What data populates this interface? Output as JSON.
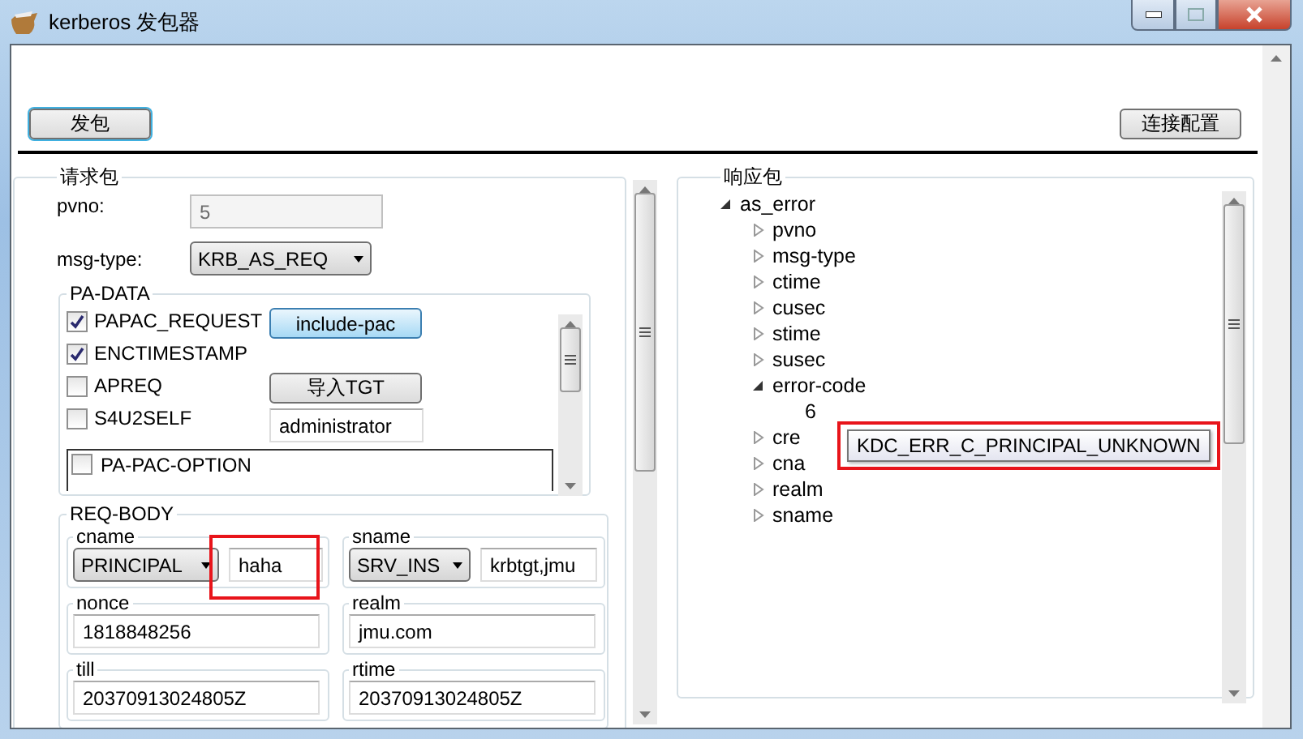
{
  "window": {
    "title": "kerberos 发包器"
  },
  "toolbar": {
    "send_button": "发包",
    "config_button": "连接配置"
  },
  "request": {
    "title": "请求包",
    "pvno": {
      "label": "pvno:",
      "value": "5",
      "disabled": true
    },
    "msg_type": {
      "label": "msg-type:",
      "value": "KRB_AS_REQ"
    },
    "pa_data": {
      "title": "PA-DATA",
      "options": [
        {
          "label": "PAPAC_REQUEST",
          "checked": true
        },
        {
          "label": "ENCTIMESTAMP",
          "checked": true
        },
        {
          "label": "APREQ",
          "checked": false
        },
        {
          "label": "S4U2SELF",
          "checked": false
        }
      ],
      "include_pac": {
        "label": "include-pac",
        "selected": true
      },
      "import_tgt": "导入TGT",
      "user": "administrator",
      "pac_option": {
        "label": "PA-PAC-OPTION",
        "checked": false
      }
    },
    "req_body": {
      "title": "REQ-BODY",
      "fields": [
        {
          "kind": "typed",
          "label": "cname",
          "type": "PRINCIPAL",
          "value": "haha",
          "highlighted": true
        },
        {
          "kind": "typed",
          "label": "sname",
          "type": "SRV_INS",
          "value": "krbtgt,jmu",
          "highlighted": false
        },
        {
          "kind": "text",
          "label": "nonce",
          "value": "1818848256"
        },
        {
          "kind": "text",
          "label": "realm",
          "value": "jmu.com"
        },
        {
          "kind": "text",
          "label": "till",
          "value": "20370913024805Z"
        },
        {
          "kind": "text",
          "label": "rtime",
          "value": "20370913024805Z"
        }
      ]
    }
  },
  "response": {
    "title": "响应包",
    "tree": [
      {
        "label": "as_error",
        "expanded": true,
        "children": [
          {
            "label": "pvno",
            "expanded": false
          },
          {
            "label": "msg-type",
            "expanded": false
          },
          {
            "label": "ctime",
            "expanded": false
          },
          {
            "label": "cusec",
            "expanded": false
          },
          {
            "label": "stime",
            "expanded": false
          },
          {
            "label": "susec",
            "expanded": false
          },
          {
            "label": "error-code",
            "expanded": true,
            "children": [
              {
                "label": "6"
              }
            ]
          },
          {
            "label": "cre",
            "expanded": false
          },
          {
            "label": "cna",
            "expanded": false
          },
          {
            "label": "realm",
            "expanded": false
          },
          {
            "label": "sname",
            "expanded": false
          }
        ]
      }
    ]
  },
  "tooltip": {
    "text": "KDC_ERR_C_PRINCIPAL_UNKNOWN",
    "highlighted": true
  }
}
